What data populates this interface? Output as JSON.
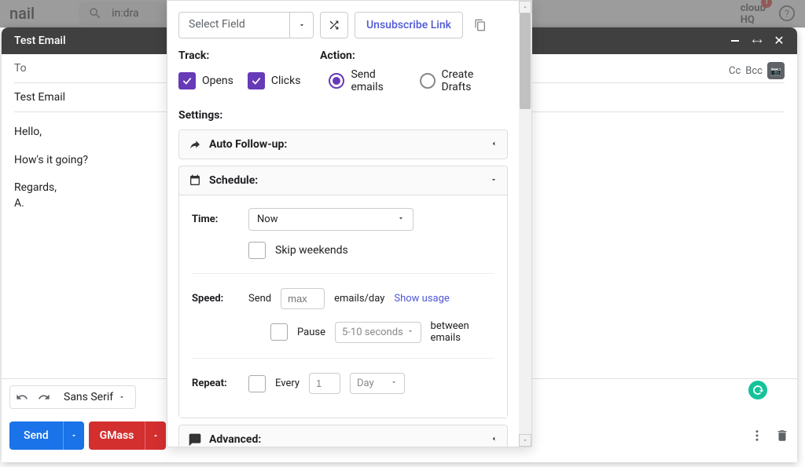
{
  "bg": {
    "logo_text": "nail",
    "search_query": "in:dra"
  },
  "compose": {
    "title": "Test Email",
    "to_label": "To",
    "subject": "Test Email",
    "cc_label": "Cc",
    "bcc_label": "Bcc",
    "body_lines": {
      "greeting": "Hello,",
      "line2": "How's it going?",
      "signoff1": "Regards,",
      "signoff2": "A."
    },
    "font_select": "Sans Serif",
    "send_label": "Send",
    "gmass_label": "GMass"
  },
  "panel": {
    "select_field_placeholder": "Select Field",
    "unsubscribe_label": "Unsubscribe Link",
    "track_label": "Track:",
    "action_label": "Action:",
    "opens_label": "Opens",
    "clicks_label": "Clicks",
    "send_emails_label": "Send emails",
    "create_drafts_label": "Create Drafts",
    "settings_label": "Settings:",
    "auto_followup_label": "Auto Follow-up:",
    "schedule_label": "Schedule:",
    "time_label": "Time:",
    "time_value": "Now",
    "skip_weekends_label": "Skip weekends",
    "speed_label": "Speed:",
    "send_word": "Send",
    "max_placeholder": "max",
    "emails_day": "emails/day",
    "show_usage": "Show usage",
    "pause_word": "Pause",
    "pause_placeholder": "5-10 seconds",
    "between_emails": "between emails",
    "repeat_label": "Repeat:",
    "every_word": "Every",
    "repeat_value": "1",
    "day_word": "Day",
    "advanced_label": "Advanced:"
  }
}
